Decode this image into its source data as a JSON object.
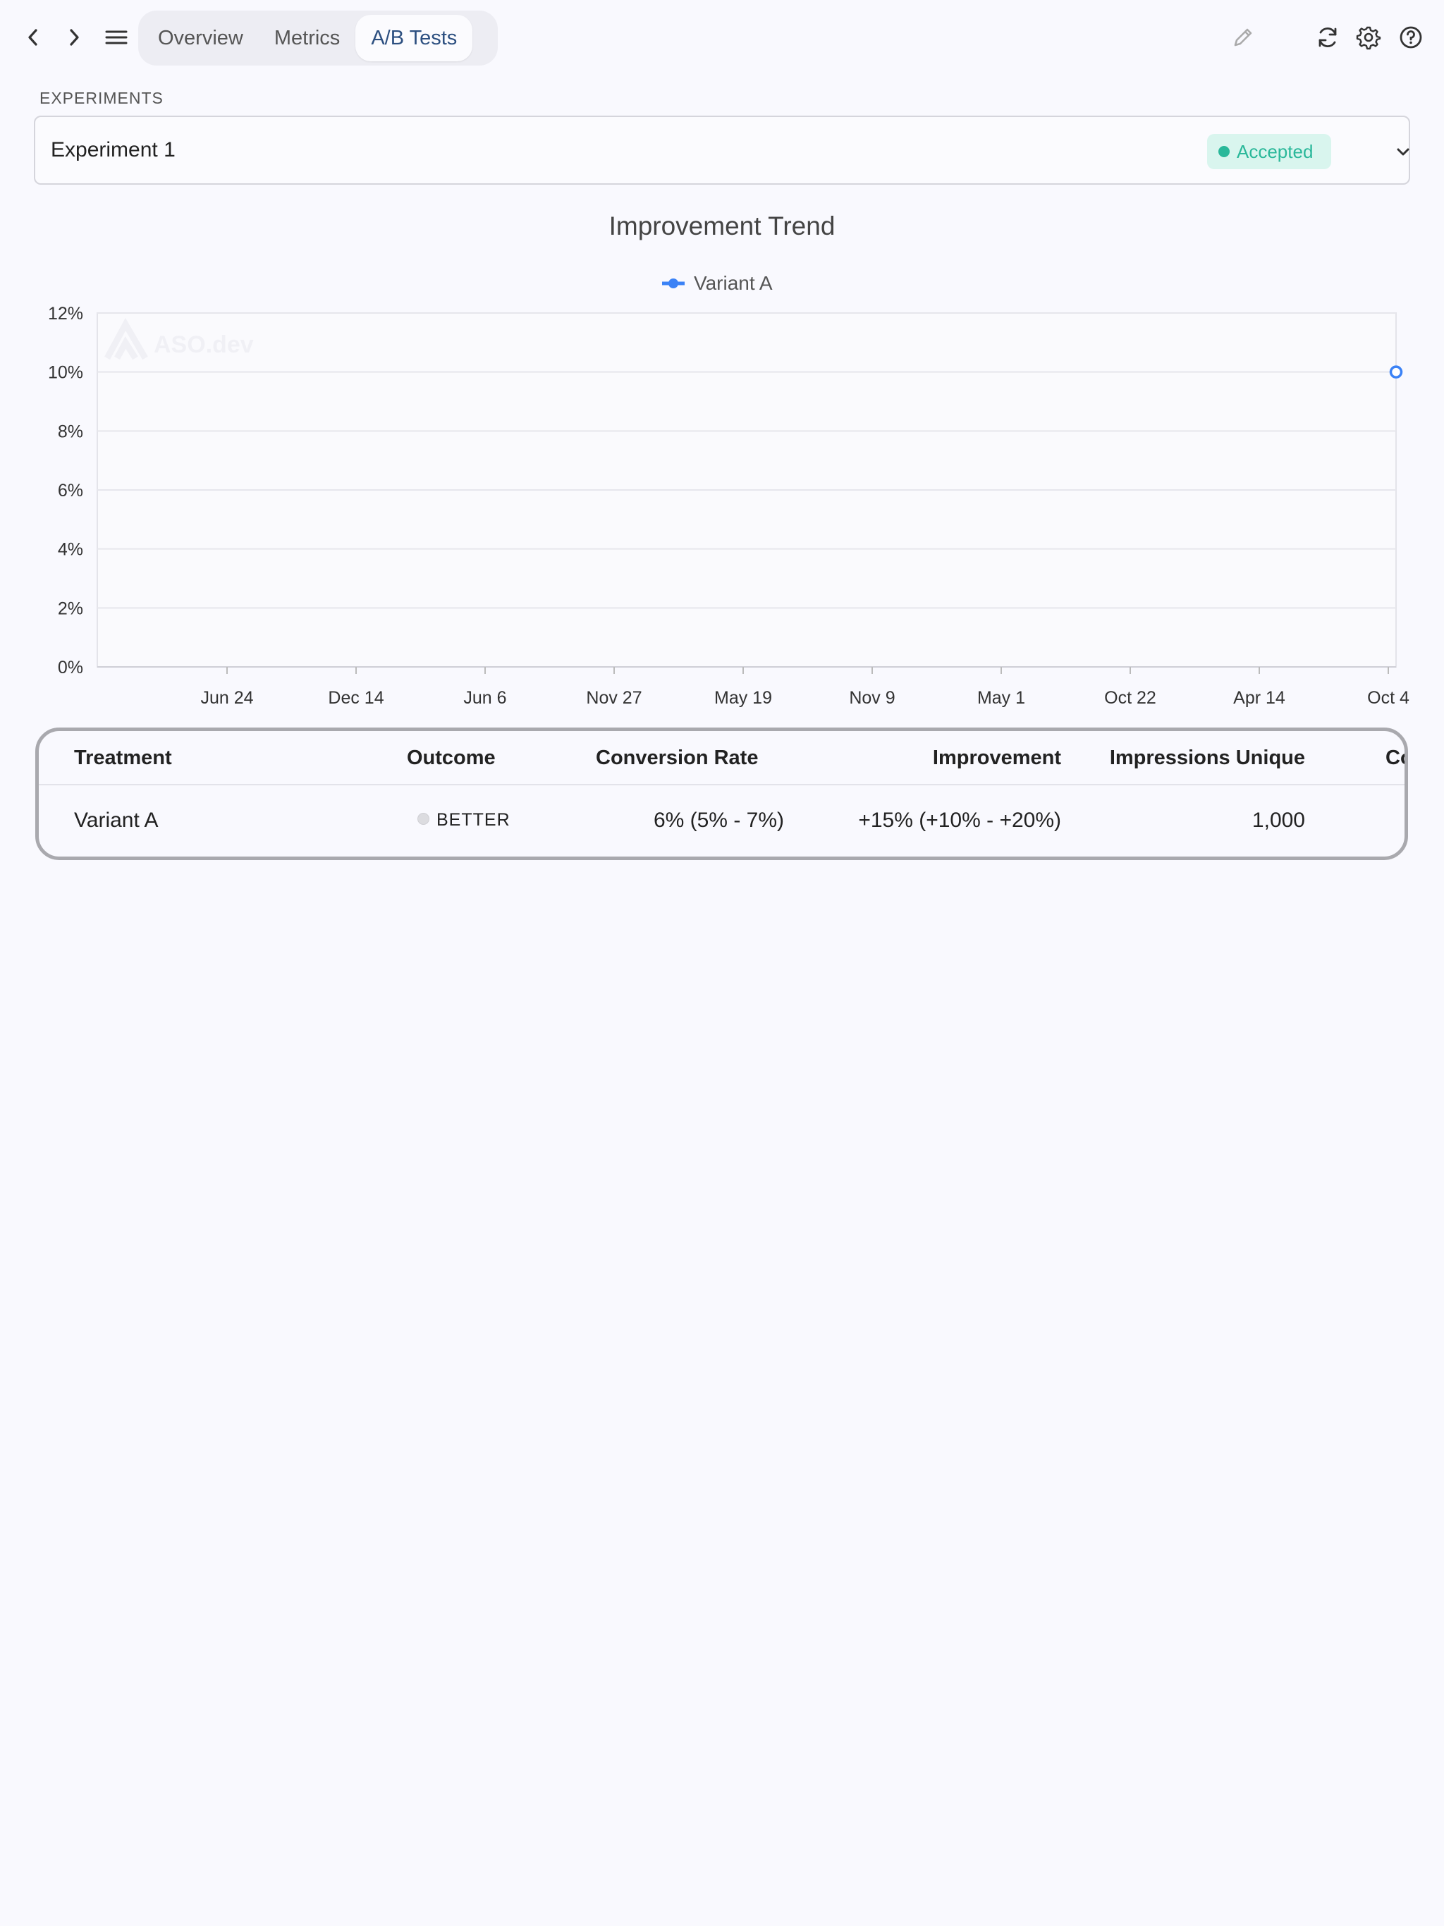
{
  "nav": {
    "back_icon": "chevron-left-icon",
    "forward_icon": "chevron-right-icon",
    "menu_icon": "hamburger-menu-icon",
    "tabs": [
      {
        "label": "Overview",
        "active": false
      },
      {
        "label": "Metrics",
        "active": false
      },
      {
        "label": "A/B Tests",
        "active": true
      }
    ],
    "right_icons": [
      "pencil-icon",
      "refresh-icon",
      "gear-icon",
      "help-icon"
    ]
  },
  "experiments": {
    "section_label": "EXPERIMENTS",
    "selected": "Experiment 1",
    "status": "Accepted",
    "status_color": "#2ab89a"
  },
  "chart_data": {
    "type": "line",
    "title": "Improvement Trend",
    "watermark": "ASO.dev",
    "x_tick_labels": [
      "Jun 24",
      "Dec 14",
      "Jun 6",
      "Nov 27",
      "May 19",
      "Nov 9",
      "May 1",
      "Oct 22",
      "Apr 14",
      "Oct 4"
    ],
    "y_tick_labels": [
      "0%",
      "2%",
      "4%",
      "6%",
      "8%",
      "10%",
      "12%"
    ],
    "ylim": [
      0,
      12
    ],
    "grid": true,
    "legend": "top-center",
    "series": [
      {
        "name": "Variant A",
        "color": "#3b82f6",
        "points": [
          {
            "x": "Oct 4",
            "y": 10
          }
        ]
      }
    ]
  },
  "table": {
    "headers": [
      "Treatment",
      "Outcome",
      "Conversion Rate",
      "Improvement",
      "Impressions Unique",
      "Co"
    ],
    "rows": [
      {
        "treatment": "Variant A",
        "outcome": "BETTER",
        "conversion_rate": "6% (5% - 7%)",
        "improvement": "+15% (+10% - +20%)",
        "impressions_unique": "1,000"
      }
    ]
  }
}
